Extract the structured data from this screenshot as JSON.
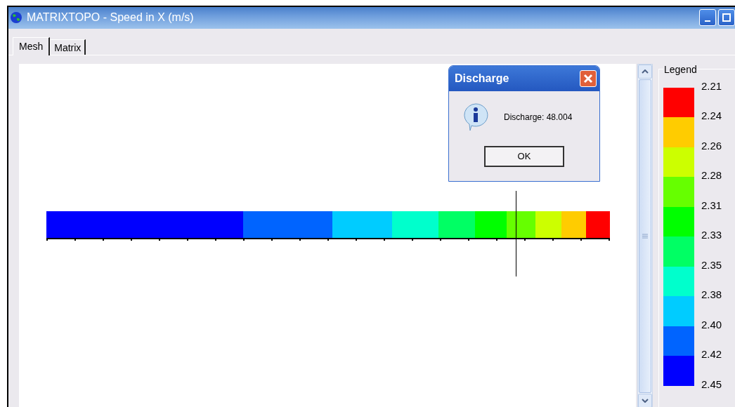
{
  "window": {
    "title": "MATRIXTOPO - Speed in X (m/s)"
  },
  "tabs": [
    {
      "label": "Mesh",
      "selected": true
    },
    {
      "label": "Matrix",
      "selected": false
    }
  ],
  "mesh": {
    "segments": [
      {
        "color": "#0000ff"
      },
      {
        "color": "#0064ff"
      },
      {
        "color": "#00ccff"
      },
      {
        "color": "#00ffcc"
      },
      {
        "color": "#00ff64"
      },
      {
        "color": "#00ff00"
      },
      {
        "color": "#66ff00"
      },
      {
        "color": "#ccff00"
      },
      {
        "color": "#ffcc00"
      },
      {
        "color": "#ff0000"
      }
    ]
  },
  "legend": {
    "title": "Legend",
    "bands": [
      {
        "color": "#ff0000"
      },
      {
        "color": "#ffcc00"
      },
      {
        "color": "#ccff00"
      },
      {
        "color": "#66ff00"
      },
      {
        "color": "#00ff00"
      },
      {
        "color": "#00ff64"
      },
      {
        "color": "#00ffcc"
      },
      {
        "color": "#00ccff"
      },
      {
        "color": "#0064ff"
      },
      {
        "color": "#0000ff"
      }
    ],
    "labels": [
      "2.21",
      "2.24",
      "2.26",
      "2.28",
      "2.31",
      "2.33",
      "2.35",
      "2.38",
      "2.40",
      "2.42",
      "2.45"
    ]
  },
  "dialog": {
    "title": "Discharge",
    "message": "Discharge: 48.004",
    "button": "OK"
  }
}
